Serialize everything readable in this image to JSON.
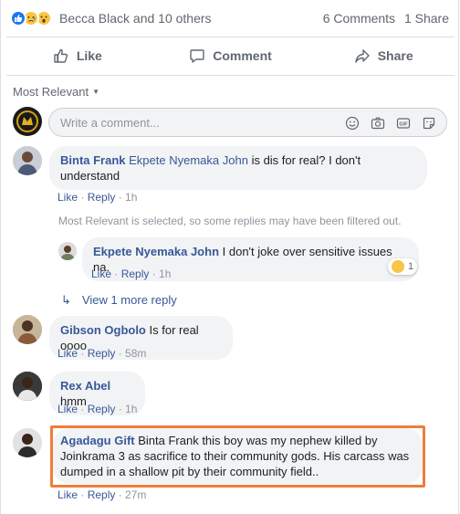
{
  "reactions": {
    "icons": [
      "like-icon",
      "sad-icon",
      "wow-icon"
    ],
    "names": "Becca Black and 10 others",
    "comments": "6 Comments",
    "shares": "1 Share"
  },
  "actions": {
    "like": "Like",
    "comment": "Comment",
    "share": "Share"
  },
  "sort": {
    "label": "Most Relevant"
  },
  "composer": {
    "placeholder": "Write a comment..."
  },
  "comments": [
    {
      "author": "Binta Frank",
      "tag": "Ekpete Nyemaka John",
      "line1": "is dis for real? I don't",
      "line2": "understand",
      "like": "Like",
      "reply": "Reply",
      "time": "1h"
    },
    {
      "author": "Gibson Ogbolo",
      "text": "Is for real oooo",
      "like": "Like",
      "reply": "Reply",
      "time": "58m"
    },
    {
      "author": "Rex Abel",
      "text": "hmm",
      "like": "Like",
      "reply": "Reply",
      "time": "1h"
    },
    {
      "author": "Agadagu Gift",
      "line1": "Binta Frank this boy was my nephew killed by",
      "line2": "Joinkrama 3 as sacrifice to their community gods. His carcass was",
      "line3": "dumped in a shallow pit by their community field..",
      "like": "Like",
      "reply": "Reply",
      "time": "27m"
    }
  ],
  "filter_notice": "Most Relevant is selected, so some replies may have been filtered out.",
  "reply": {
    "author": "Ekpete Nyemaka John",
    "text": "I don't joke over sensitive issues na.",
    "like": "Like",
    "reply": "Reply",
    "time": "1h",
    "reaction_count": "1"
  },
  "view_more": "View 1 more reply",
  "colors": {
    "link": "#385898",
    "highlight": "#f07d3a",
    "bubble": "#f2f3f5"
  }
}
